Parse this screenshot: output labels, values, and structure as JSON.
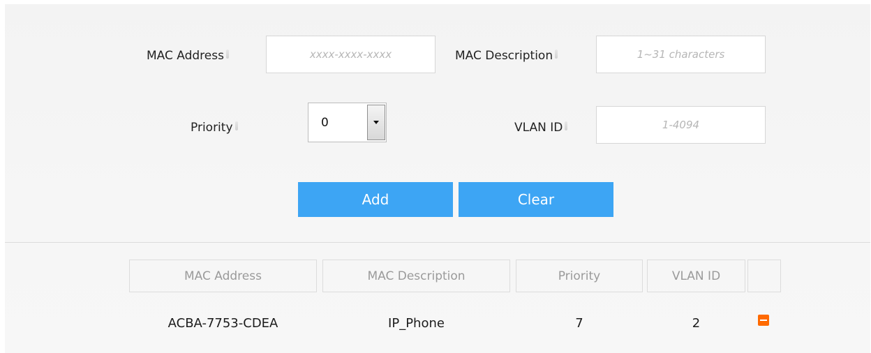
{
  "form": {
    "mac_address_label": "MAC Address",
    "mac_address_placeholder": "xxxx-xxxx-xxxx",
    "mac_address_value": "",
    "mac_description_label": "MAC Description",
    "mac_description_placeholder": "1~31 characters",
    "mac_description_value": "",
    "priority_label": "Priority",
    "priority_selected": "0",
    "vlan_id_label": "VLAN ID",
    "vlan_id_placeholder": "1-4094",
    "vlan_id_value": "",
    "add_label": "Add",
    "clear_label": "Clear"
  },
  "table": {
    "headers": [
      "MAC Address",
      "MAC Description",
      "Priority",
      "VLAN ID",
      ""
    ],
    "rows": [
      {
        "mac_address": "ACBA-7753-CDEA",
        "mac_description": "IP_Phone",
        "priority": "7",
        "vlan_id": "2",
        "action_icon": "minus-icon"
      }
    ]
  },
  "colors": {
    "button": "#3da5f4",
    "delete": "#ff6a00"
  }
}
